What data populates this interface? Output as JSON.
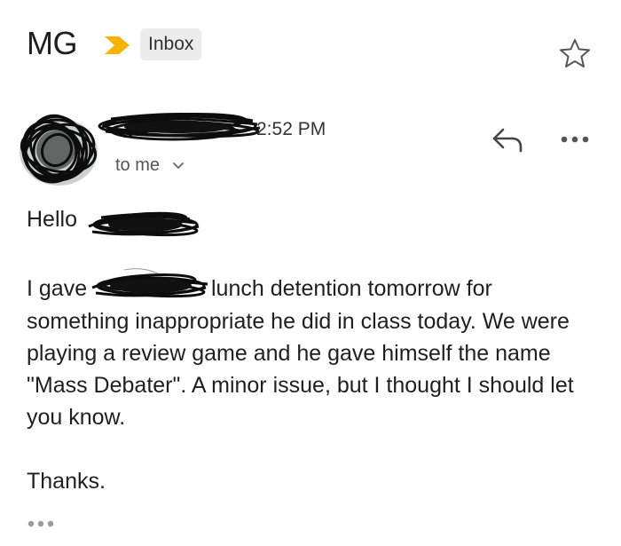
{
  "header": {
    "subject": "MG",
    "label": "Inbox",
    "importance_icon": "importance-marker-icon",
    "star_icon": "star-icon",
    "importance_color": "#F4B400"
  },
  "message": {
    "time": "2:52 PM",
    "recipient": "to me",
    "reply_icon": "reply-icon",
    "more_icon": "more-horizontal-icon",
    "avatar": "redacted-avatar",
    "sender": "redacted-sender-name"
  },
  "body": {
    "greeting": "Hello",
    "line1_start": "I gave",
    "line1_end": "lunch detention tomorrow for",
    "rest": "something inappropriate he did in class today. We were playing a review game and he gave himself the name \"Mass Debater\". A minor issue, but I thought I should let you know.",
    "signoff": "Thanks.",
    "trim_icon": "show-trimmed-content-icon"
  }
}
